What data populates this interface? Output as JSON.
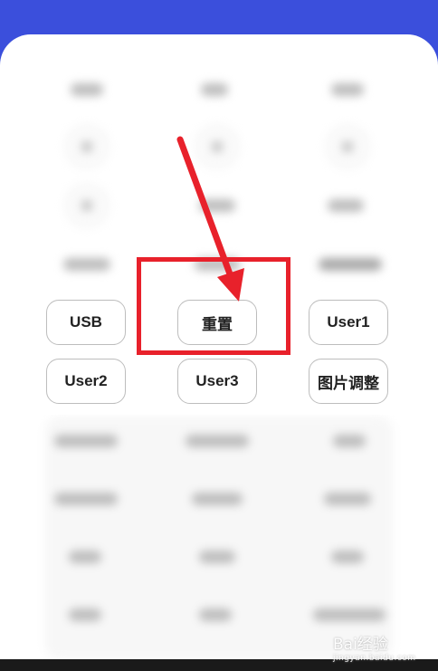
{
  "buttons": {
    "usb": "USB",
    "reset": "重置",
    "user1": "User1",
    "user2": "User2",
    "user3": "User3",
    "picture_adjust": "图片调整"
  },
  "watermark": {
    "brand": "Bai经验",
    "url": "jingyan.baidu.com"
  },
  "colors": {
    "header_blue": "#3b4fdc",
    "annotation_red": "#e8212b"
  }
}
